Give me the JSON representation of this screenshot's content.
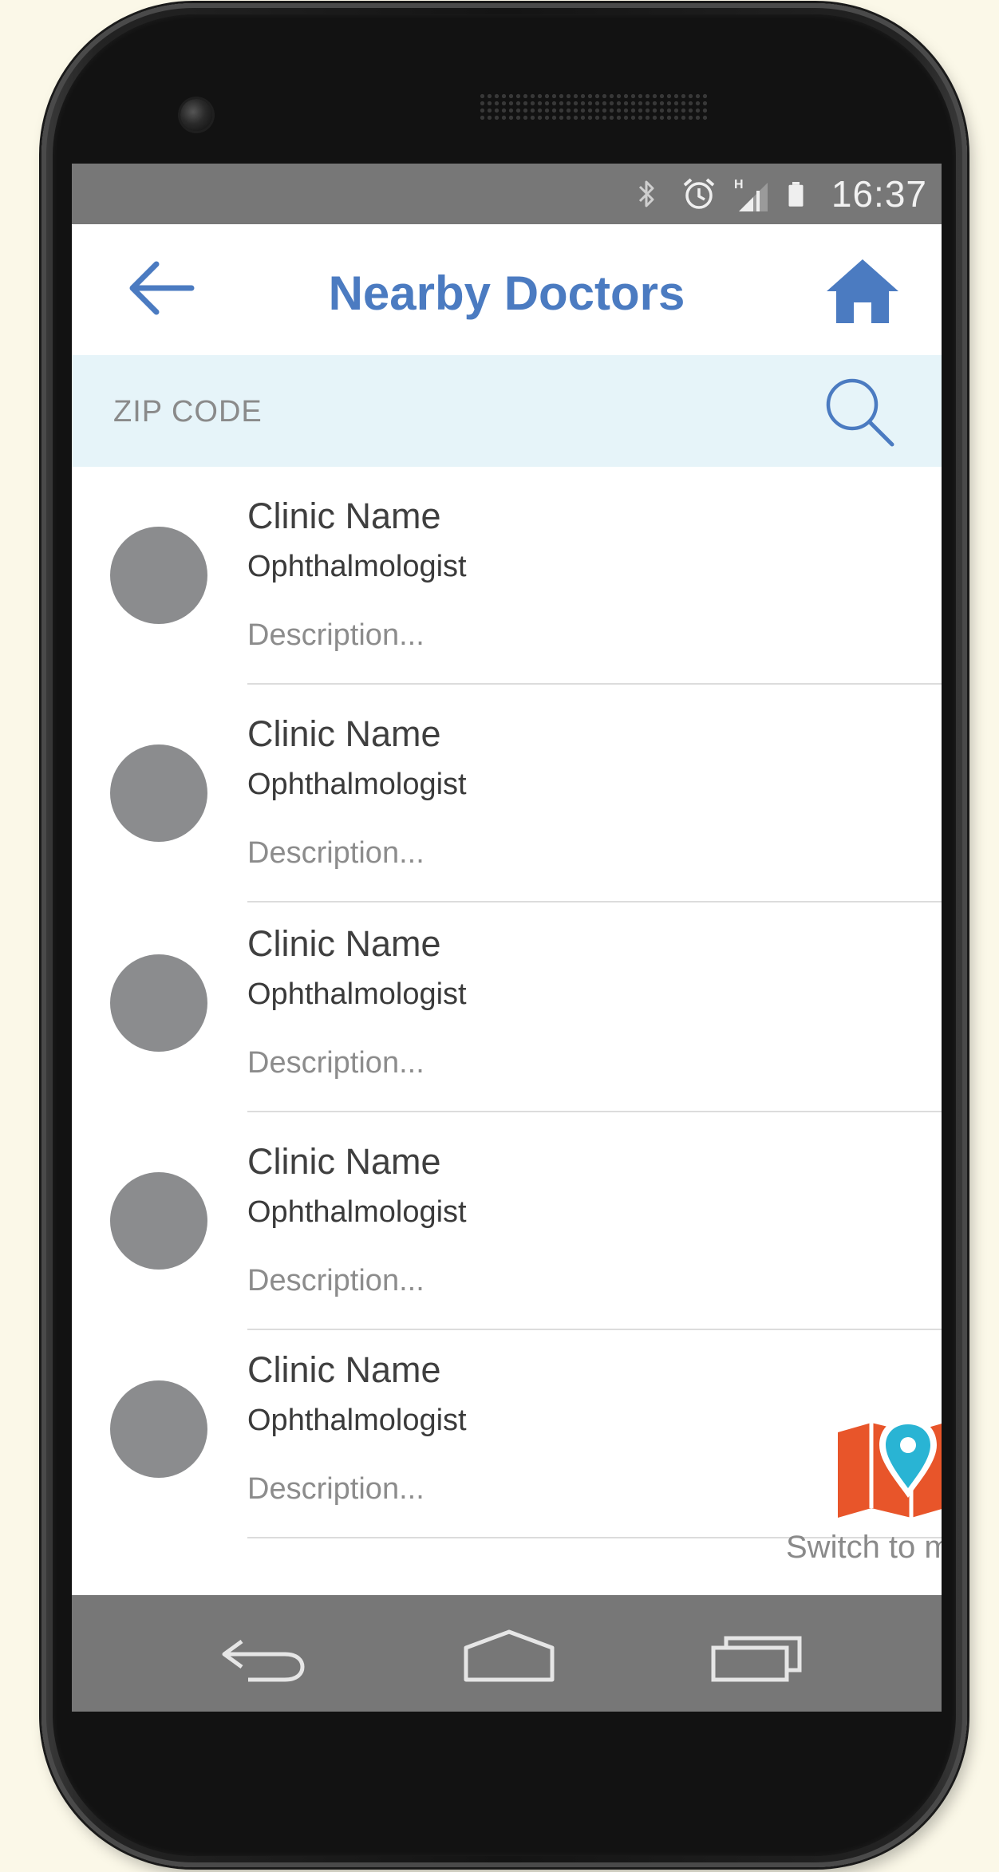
{
  "status_bar": {
    "time": "16:37",
    "icons": [
      "bluetooth-icon",
      "alarm-icon",
      "signal-icon",
      "battery-icon"
    ],
    "network_type": "H"
  },
  "header": {
    "title": "Nearby Doctors",
    "back_icon": "arrow-left-icon",
    "home_icon": "home-icon",
    "accent_color": "#4b7bc1"
  },
  "search": {
    "placeholder": "ZIP CODE",
    "value": "",
    "icon": "search-icon",
    "background": "#e6f4f9"
  },
  "doctors": [
    {
      "name": "Clinic Name",
      "specialty": "Ophthalmologist",
      "description": "Description..."
    },
    {
      "name": "Clinic Name",
      "specialty": "Ophthalmologist",
      "description": "Description..."
    },
    {
      "name": "Clinic Name",
      "specialty": "Ophthalmologist",
      "description": "Description..."
    },
    {
      "name": "Clinic Name",
      "specialty": "Ophthalmologist",
      "description": "Description..."
    },
    {
      "name": "Clinic Name",
      "specialty": "Ophthalmologist",
      "description": "Description..."
    }
  ],
  "map_switch": {
    "label": "Switch to map",
    "icon": "map-pin-icon",
    "map_color": "#e8552a",
    "pin_color": "#29b4d4"
  },
  "nav_bar": {
    "buttons": [
      "nav-back-icon",
      "nav-home-icon",
      "nav-recent-apps-icon"
    ]
  }
}
